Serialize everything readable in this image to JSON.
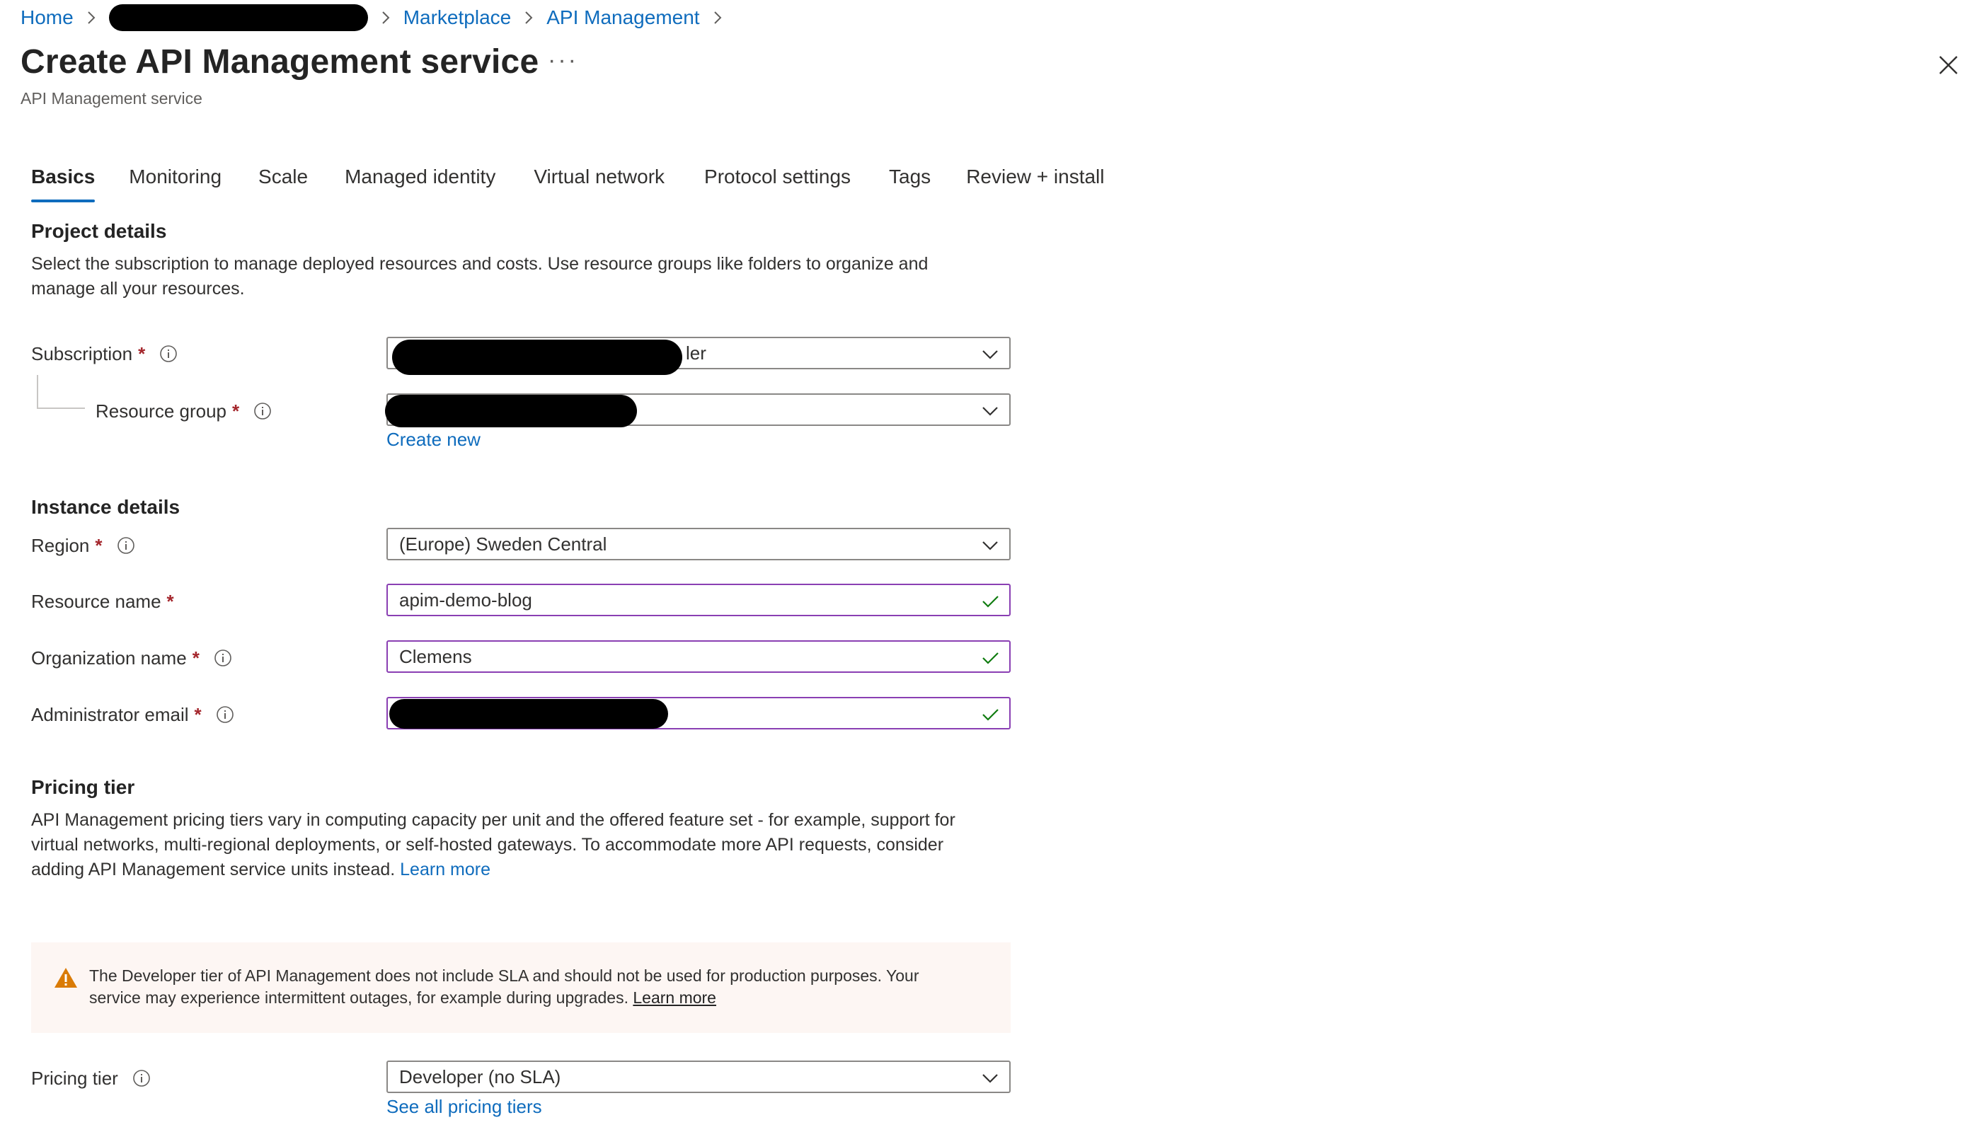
{
  "breadcrumb": {
    "home": "Home",
    "marketplace": "Marketplace",
    "api_management": "API Management"
  },
  "header": {
    "title": "Create API Management service",
    "subtitle": "API Management service",
    "more": "···"
  },
  "tabs": [
    {
      "label": "Basics",
      "active": true
    },
    {
      "label": "Monitoring"
    },
    {
      "label": "Scale"
    },
    {
      "label": "Managed identity"
    },
    {
      "label": "Virtual network"
    },
    {
      "label": "Protocol settings"
    },
    {
      "label": "Tags"
    },
    {
      "label": "Review + install"
    }
  ],
  "project": {
    "title": "Project details",
    "description": "Select the subscription to manage deployed resources and costs. Use resource groups like folders to organize and manage all your resources.",
    "subscription_label": "Subscription",
    "subscription_value_tail": "ler",
    "resource_group_label": "Resource group",
    "create_new": "Create new"
  },
  "instance": {
    "title": "Instance details",
    "region_label": "Region",
    "region_value": "(Europe) Sweden Central",
    "resource_name_label": "Resource name",
    "resource_name_value": "apim-demo-blog",
    "org_name_label": "Organization name",
    "org_name_value": "Clemens",
    "admin_email_label": "Administrator email"
  },
  "pricing": {
    "title": "Pricing tier",
    "description": "API Management pricing tiers vary in computing capacity per unit and the offered feature set - for example, support for virtual networks, multi-regional deployments, or self-hosted gateways. To accommodate more API requests, consider adding API Management service units instead.",
    "learn_more": "Learn more",
    "warning_text": "The Developer tier of API Management does not include SLA and should not be used for production purposes. Your service may experience intermittent outages, for example during upgrades.",
    "warning_learn_more": "Learn more",
    "tier_label": "Pricing tier",
    "tier_value": "Developer (no SLA)",
    "see_all": "See all pricing tiers"
  },
  "required_mark": "*",
  "colors": {
    "link": "#0f6cbd",
    "required": "#a4262c",
    "valid_border": "#8a3fb3",
    "check": "#107c10",
    "warning_icon": "#da7b06",
    "warning_bg": "#fdf6f3"
  }
}
